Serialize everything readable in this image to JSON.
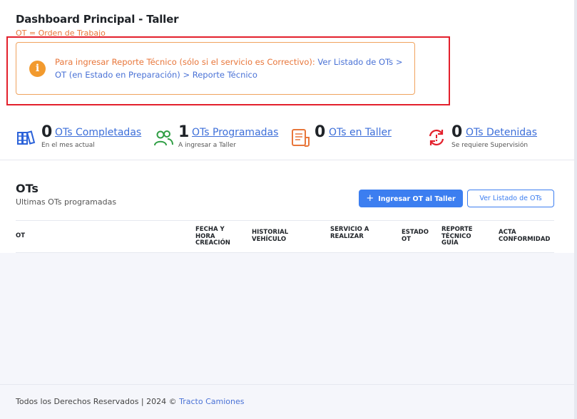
{
  "header": {
    "title": "Dashboard Principal - Taller",
    "subtitle": "OT = Orden de Trabajo"
  },
  "alert": {
    "icon": "info-icon",
    "icon_glyph": "i",
    "text": "Para ingresar Reporte Técnico (sólo si el servicio es Correctivo): ",
    "link_text": "Ver Listado de OTs > OT (en Estado en Preparación) > Reporte Técnico",
    "color": "#e8763a",
    "border_color": "#f0a35e",
    "highlight_color": "#e3202c"
  },
  "stats": [
    {
      "icon": "books-icon",
      "value": "0",
      "label": "OTs Completadas",
      "sub": "En el mes actual",
      "color": "#2b62d9"
    },
    {
      "icon": "users-icon",
      "value": "1",
      "label": "OTs Programadas",
      "sub": "A ingresar a Taller",
      "color": "#2f9e44"
    },
    {
      "icon": "clipboard-icon",
      "value": "0",
      "label": "OTs en Taller",
      "sub": "",
      "color": "#e8763a"
    },
    {
      "icon": "refresh-alert-icon",
      "value": "0",
      "label": "OTs Detenidas",
      "sub": "Se requiere Supervisión",
      "color": "#e3202c"
    }
  ],
  "ots": {
    "title": "OTs",
    "subtitle": "Ultimas OTs programadas",
    "add_button": "Ingresar OT al Taller",
    "add_icon": "+",
    "list_button": "Ver Listado de OTs",
    "columns": [
      "OT",
      "FECHA Y HORA CREACIÓN",
      "HISTORIAL VEHÍCULO",
      "SERVICIO A REALIZAR",
      "ESTADO OT",
      "REPORTE TÉCNICO GUÍA",
      "ACTA CONFORMIDAD"
    ],
    "rows": []
  },
  "footer": {
    "text": "Todos los Derechos Reservados  | 2024 © ",
    "link": "Tracto Camiones"
  }
}
